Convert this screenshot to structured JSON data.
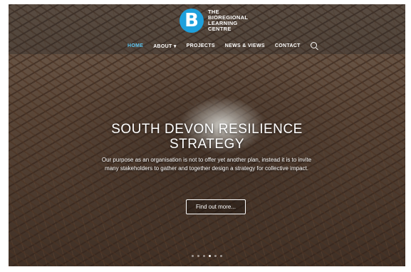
{
  "brand": {
    "mark": "B",
    "line1": "THE",
    "line2": "BIOREGIONAL",
    "line3": "LEARNING",
    "line4": "CENTRE",
    "color": "#1ea0dc"
  },
  "nav": {
    "items": [
      {
        "label": "HOME",
        "active": true
      },
      {
        "label": "ABOUT ▾",
        "active": false
      },
      {
        "label": "PROJECTS",
        "active": false
      },
      {
        "label": "NEWS & VIEWS",
        "active": false
      },
      {
        "label": "CONTACT",
        "active": false
      }
    ],
    "search_icon": "search-icon"
  },
  "hero": {
    "title_line1": "SOUTH DEVON RESILIENCE",
    "title_line2": "STRATEGY",
    "description": "Our purpose as an organisation is not to offer yet another plan, instead it is to invite many stakeholders to gather and together design a strategy for collective impact.",
    "cta": "Find out more..."
  },
  "slider": {
    "count": 6,
    "active_index": 3
  }
}
